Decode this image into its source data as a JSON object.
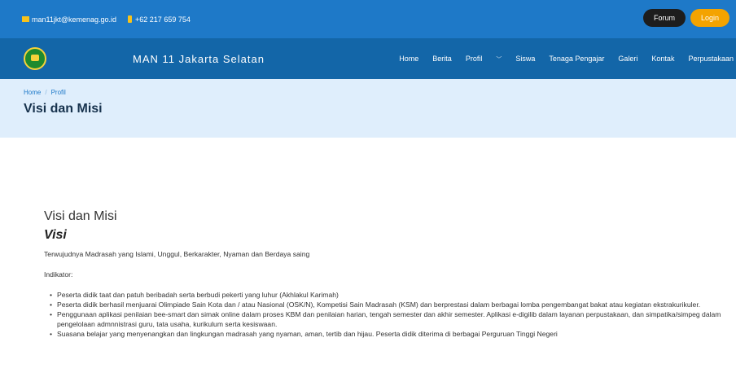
{
  "topbar": {
    "email": "man11jkt@kemenag.go.id",
    "phone": "+62 217 659 754",
    "forum_label": "Forum",
    "login_label": "Login"
  },
  "navbar": {
    "site_title": "MAN 11 Jakarta Selatan",
    "items": [
      "Home",
      "Berita",
      "Profil",
      "Siswa",
      "Tenaga Pengajar",
      "Galeri",
      "Kontak",
      "Perpustakaan"
    ]
  },
  "hero": {
    "breadcrumb_home": "Home",
    "breadcrumb_sep": "/",
    "breadcrumb_current": "Profil",
    "title": "Visi dan Misi"
  },
  "content": {
    "heading": "Visi dan Misi",
    "visi_heading": "Visi",
    "visi_text": "Terwujudnya Madrasah yang Islami, Unggul, Berkarakter, Nyaman dan Berdaya saing",
    "indikator_label": "Indikator:",
    "indikator": [
      "Peserta didik taat dan patuh beribadah serta berbudi pekerti yang luhur (Akhlakul Karimah)",
      "Peserta didik berhasil menjuarai Olimpiade Sain Kota dan / atau Nasional (OSK/N), Kompetisi Sain Madrasah (KSM) dan berprestasi dalam berbagai lomba pengembangat bakat atau kegiatan ekstrakurikuler.",
      "Penggunaan aplikasi penilaian bee-smart dan simak online dalam proses KBM dan penilaian harian, tengah semester dan akhir semester. Aplikasi e-digilib dalam layanan perpustakaan, dan simpatika/simpeg dalam pengelolaan admnnistrasi guru, tata usaha, kurikulum serta kesiswaan.",
      "Suasana belajar yang menyenangkan dan lingkungan madrasah yang nyaman, aman, tertib dan hijau. Peserta didik diterima di berbagai Perguruan Tinggi Negeri"
    ]
  },
  "colors": {
    "topbar": "#1e79c8",
    "navbar": "#1366a8",
    "hero": "#dfeefc",
    "login": "#f4a300",
    "forum": "#1d1d1d"
  }
}
